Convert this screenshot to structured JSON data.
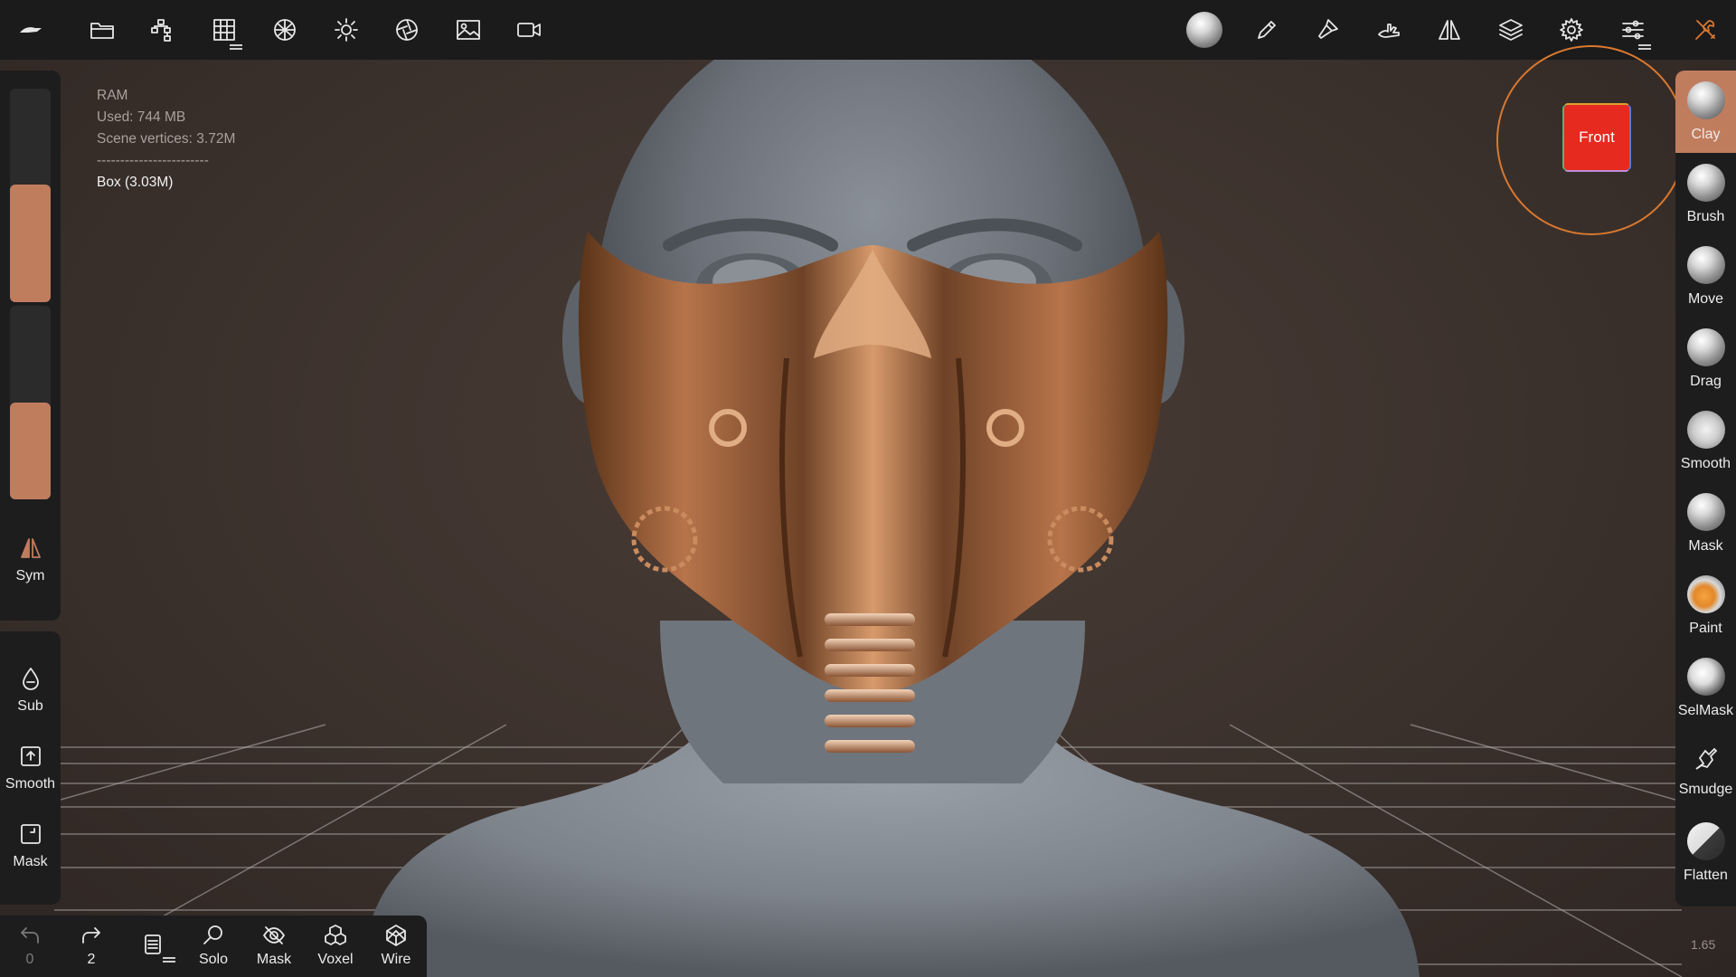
{
  "topbar": {
    "left_icons": [
      "nomad-logo-icon",
      "folder-icon",
      "scene-tree-icon",
      "grid-topology-icon",
      "material-sphere-icon",
      "light-icon",
      "camera-shutter-icon",
      "image-icon",
      "video-camera-icon"
    ],
    "right_icons": [
      "matcap-sphere-icon",
      "pencil-stroke-icon",
      "painter-icon",
      "hand-brush-icon",
      "symmetry-icon",
      "layers-icon",
      "settings-icon",
      "sliders-icon",
      "tools-icon"
    ]
  },
  "stats": {
    "title": "RAM",
    "used": "Used: 744 MB",
    "vertices": "Scene vertices: 3.72M",
    "separator": "------------------------",
    "object": "Box (3.03M)"
  },
  "left_panel": {
    "sym_label": "Sym",
    "slider1_fill": 0.55,
    "slider2_fill": 0.5,
    "tools": [
      {
        "label": "Sub",
        "icon": "drop-icon"
      },
      {
        "label": "Smooth",
        "icon": "box-up-icon"
      },
      {
        "label": "Mask",
        "icon": "box-mask-icon"
      }
    ]
  },
  "bottom_bar": {
    "undo_count": "0",
    "redo_count": "2",
    "solo": "Solo",
    "mask": "Mask",
    "voxel": "Voxel",
    "wire": "Wire"
  },
  "right_tools": [
    {
      "label": "Clay",
      "active": true
    },
    {
      "label": "Brush"
    },
    {
      "label": "Move"
    },
    {
      "label": "Drag"
    },
    {
      "label": "Smooth"
    },
    {
      "label": "Mask"
    },
    {
      "label": "Paint"
    },
    {
      "label": "SelMask"
    },
    {
      "label": "Smudge"
    },
    {
      "label": "Flatten"
    }
  ],
  "gizmo": {
    "front_label": "Front"
  },
  "zoom": "1.65",
  "colors": {
    "accent": "#c07d5e",
    "gizmo_ring": "#d9782f",
    "front_face": "#e62a1f",
    "panel_bg": "#1d1d1e"
  }
}
